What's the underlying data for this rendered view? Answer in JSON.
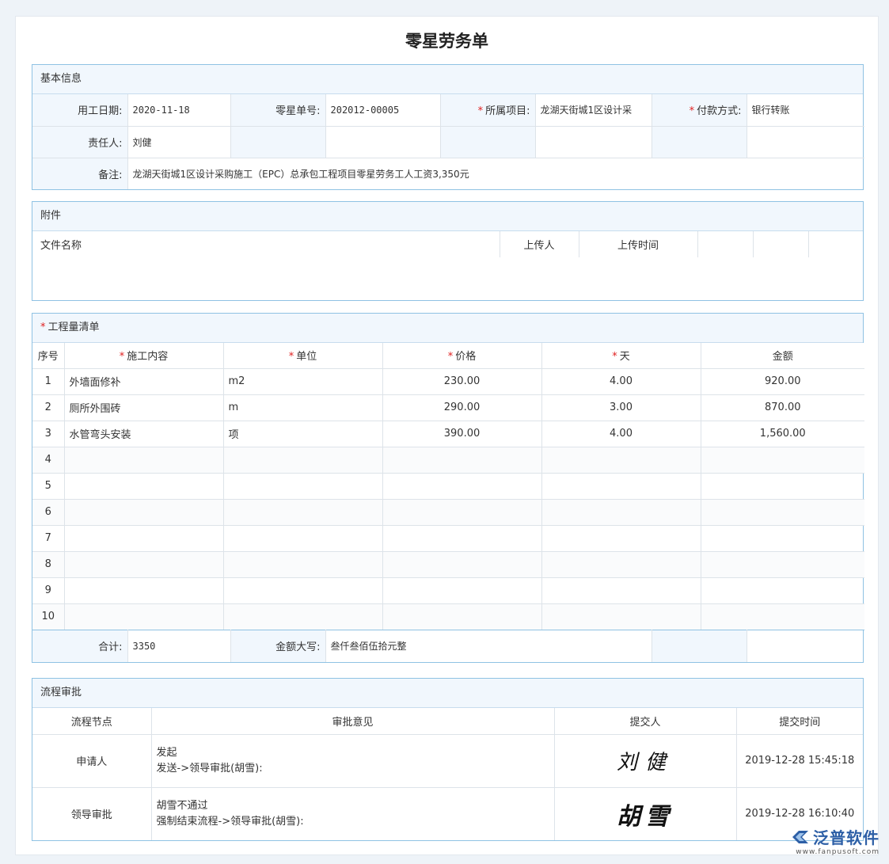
{
  "title": "零星劳务单",
  "basic": {
    "header": "基本信息",
    "date_label": "用工日期:",
    "date_value": "2020-11-18",
    "no_label": "零星单号:",
    "no_value": "202012-00005",
    "project_label": "所属项目:",
    "project_value": "龙湖天街城1区设计采",
    "pay_label": "付款方式:",
    "pay_value": "银行转账",
    "owner_label": "责任人:",
    "owner_value": "刘健",
    "remark_label": "备注:",
    "remark_value": "龙湖天街城1区设计采购施工（EPC）总承包工程项目零星劳务工人工资3,350元"
  },
  "attachment": {
    "header": "附件",
    "columns": [
      "文件名称",
      "上传人",
      "上传时间"
    ]
  },
  "items": {
    "header": "工程量清单",
    "columns": {
      "no": "序号",
      "content": "施工内容",
      "unit": "单位",
      "price": "价格",
      "days": "天",
      "amount": "金额"
    },
    "rows": [
      {
        "no": "1",
        "content": "外墙面修补",
        "unit": "m2",
        "price": "230.00",
        "days": "4.00",
        "amount": "920.00"
      },
      {
        "no": "2",
        "content": "厕所外围砖",
        "unit": "m",
        "price": "290.00",
        "days": "3.00",
        "amount": "870.00"
      },
      {
        "no": "3",
        "content": "水管弯头安装",
        "unit": "项",
        "price": "390.00",
        "days": "4.00",
        "amount": "1,560.00"
      },
      {
        "no": "4"
      },
      {
        "no": "5"
      },
      {
        "no": "6"
      },
      {
        "no": "7"
      },
      {
        "no": "8"
      },
      {
        "no": "9"
      },
      {
        "no": "10"
      }
    ],
    "total_label": "合计:",
    "total_value": "3350",
    "upper_label": "金额大写:",
    "upper_value": "叁仟叁佰伍拾元整"
  },
  "flow": {
    "header": "流程审批",
    "columns": {
      "node": "流程节点",
      "opinion": "审批意见",
      "submitter": "提交人",
      "time": "提交时间"
    },
    "rows": [
      {
        "node": "申请人",
        "opinion_1": "发起",
        "opinion_2": "发送->领导审批(胡雪):",
        "signature": "刘健",
        "time": "2019-12-28 15:45:18"
      },
      {
        "node": "领导审批",
        "opinion_1": "胡雪不通过",
        "opinion_2": "强制结束流程->领导审批(胡雪):",
        "signature": "胡雪",
        "time": "2019-12-28 16:10:40"
      }
    ]
  },
  "logo": {
    "name": "泛普软件",
    "url": "www.fanpusoft.com",
    "color": "#2d5fa6"
  }
}
